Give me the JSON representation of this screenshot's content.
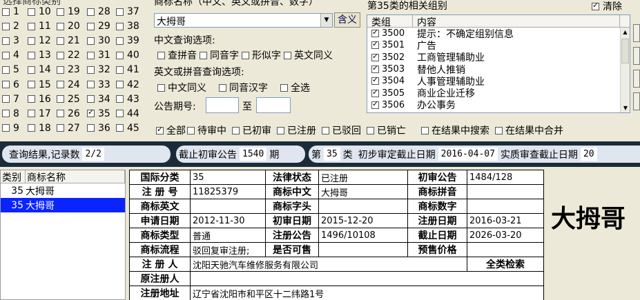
{
  "class_panel": {
    "title_partial": "选择商标类别",
    "columns": [
      [
        "1",
        "2",
        "3",
        "4",
        "5",
        "6",
        "7",
        "8",
        "9"
      ],
      [
        "10",
        "11",
        "12",
        "13",
        "14",
        "15",
        "16",
        "17",
        "18"
      ],
      [
        "19",
        "20",
        "21",
        "22",
        "23",
        "24",
        "25",
        "26",
        "27"
      ],
      [
        "28",
        "29",
        "30",
        "31",
        "32",
        "33",
        "34",
        "35",
        "36"
      ],
      [
        "37",
        "38",
        "39",
        "40",
        "41",
        "42",
        "43",
        "44",
        "45"
      ]
    ],
    "checked": [
      "35"
    ]
  },
  "search": {
    "label": "商标名称（中文、英文或拼音、数字）",
    "value": "大拇哥",
    "meaning_button": "含义",
    "cn_options_label": "中文查询选项:",
    "cn_options": [
      "查拼音",
      "同音字",
      "形似字",
      "英文同义"
    ],
    "en_options_label": "英文或拼音查询选项:",
    "en_options": [
      "中文同义",
      "同音汉字",
      "全选"
    ],
    "period_label": "公告期号:",
    "period_to": "至",
    "period_from_value": "",
    "period_to_value": ""
  },
  "groups": {
    "title": "第35类的相关组别",
    "clear_label": "清除",
    "col_group": "类组",
    "col_content": "内容",
    "rows": [
      {
        "code": "3500",
        "name": "提示：不确定组别信息"
      },
      {
        "code": "3501",
        "name": "广告"
      },
      {
        "code": "3502",
        "name": "工商管理辅助业"
      },
      {
        "code": "3503",
        "name": "替他人推销"
      },
      {
        "code": "3504",
        "name": "人事管理辅助业"
      },
      {
        "code": "3505",
        "name": "商业企业迁移"
      },
      {
        "code": "3506",
        "name": "办公事务"
      }
    ]
  },
  "filters": [
    "全部",
    "待审中",
    "已初审",
    "已注册",
    "已驳回",
    "已销亡",
    "在结果中搜索",
    "在结果中合并"
  ],
  "status_bar": {
    "result_label": "查询结果,记录数",
    "result_value": "2/2",
    "deadline_label": "截止初审公告",
    "deadline_value": "1540",
    "deadline_unit": "期",
    "class_prefix": "第",
    "class_value": "35",
    "class_suffix": "类",
    "prelim_label": "初步审定截止日期",
    "prelim_value": "2016-04-07",
    "exam_label": "实质审查截止日期",
    "exam_value": "20"
  },
  "result_list": {
    "col_class": "类别",
    "col_name": "商标名称",
    "rows": [
      {
        "cls": "35",
        "name": "大拇哥",
        "selected": false
      },
      {
        "cls": "35",
        "name": "大拇哥",
        "selected": true
      }
    ]
  },
  "detail": {
    "intl_class_label": "国际分类",
    "intl_class": "35",
    "legal_status_label": "法律状态",
    "legal_status": "已注册",
    "prelim_pub_label": "初审公告",
    "prelim_pub": "1484/128",
    "reg_no_label": "注 册 号",
    "reg_no": "11825379",
    "cn_label": "商标中文",
    "cn_value": "大拇哥",
    "pinyin_label": "商标拼音",
    "pinyin_value": "",
    "en_label": "商标英文",
    "en_value": "",
    "head_label": "商标字头",
    "head_value": "",
    "num_label": "商标数字",
    "num_value": "",
    "apply_date_label": "申请日期",
    "apply_date": "2012-11-30",
    "prelim_date_label": "初审日期",
    "prelim_date": "2015-12-20",
    "reg_date_label": "注册日期",
    "reg_date": "2016-03-21",
    "type_label": "商标类型",
    "type_value": "普通",
    "reg_pub_label": "注册公告",
    "reg_pub": "1496/10108",
    "expiry_label": "截止日期",
    "expiry": "2026-03-20",
    "flow_label": "商标流程",
    "flow_value": "驳回复审注册;",
    "shared_label": "是否可售",
    "shared_value": "",
    "price_label": "预售价格",
    "price_value": "",
    "registrant_label": "注 册 人",
    "registrant": "沈阳天驰汽车维修服务有限公司",
    "full_search": "全类检索",
    "orig_registrant_label": "原注册人",
    "orig_registrant": "",
    "address_label": "注册地址",
    "address": "辽宁省沈阳市和平区十二纬路1号"
  },
  "preview_name": "大拇哥"
}
